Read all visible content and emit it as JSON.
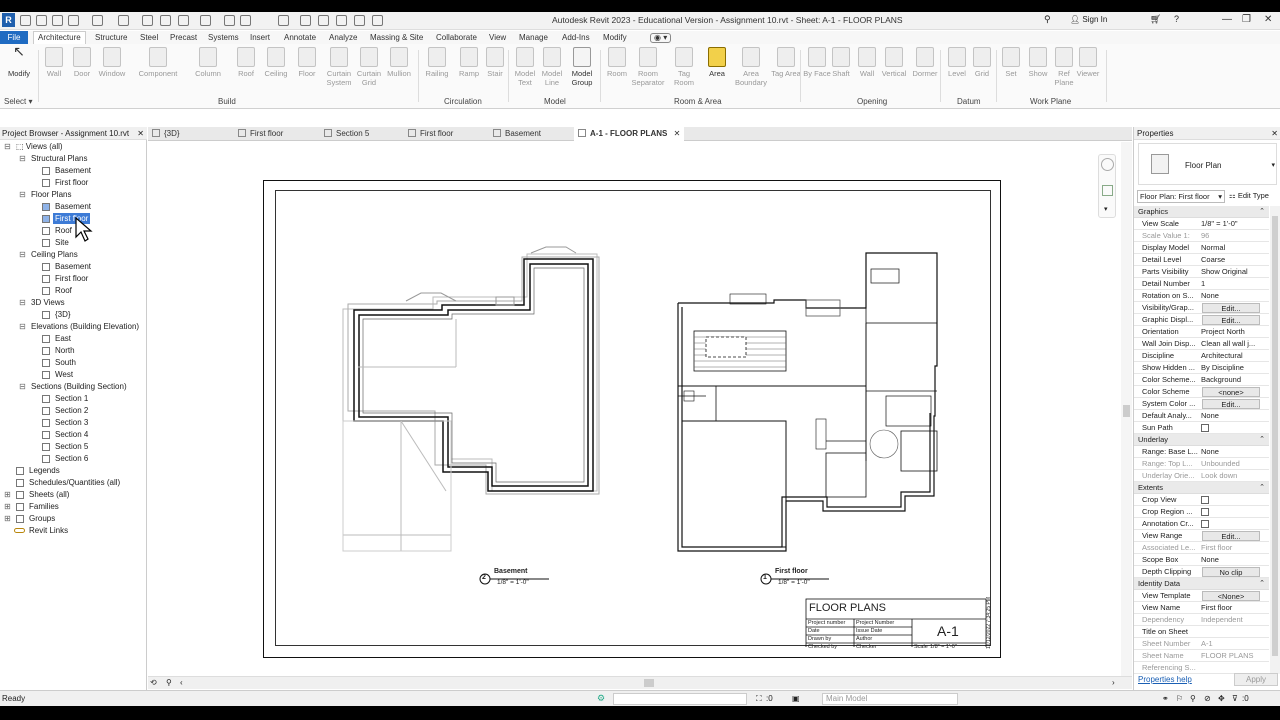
{
  "title_bar": {
    "app_title": "Autodesk Revit 2023 - Educational Version - Assignment 10.rvt - Sheet: A-1 - FLOOR PLANS",
    "sign_in": "Sign In",
    "logo": "R"
  },
  "ribbon_tabs": [
    "File",
    "Architecture",
    "Structure",
    "Steel",
    "Precast",
    "Systems",
    "Insert",
    "Annotate",
    "Analyze",
    "Massing & Site",
    "Collaborate",
    "View",
    "Manage",
    "Add-Ins",
    "Modify"
  ],
  "ribbon": {
    "modify": "Modify",
    "select": "Select",
    "groups": [
      "Build",
      "Circulation",
      "Model",
      "Room & Area",
      "Opening",
      "Datum",
      "Work Plane"
    ],
    "buttons": [
      "Wall",
      "Door",
      "Window",
      "Component",
      "Column",
      "Roof",
      "Ceiling",
      "Floor",
      "Curtain System",
      "Curtain Grid",
      "Mullion",
      "Railing",
      "Ramp",
      "Stair",
      "Model Text",
      "Model Line",
      "Model Group",
      "Room",
      "Room Separator",
      "Tag Room",
      "Area",
      "Area Boundary",
      "Tag Area",
      "By Face",
      "Shaft",
      "Wall",
      "Vertical",
      "Dormer",
      "Level",
      "Grid",
      "Set",
      "Show",
      "Ref Plane",
      "Viewer"
    ]
  },
  "project_browser": {
    "title": "Project Browser - Assignment 10.rvt",
    "tree": {
      "views_all": "Views (all)",
      "structural_plans": "Structural Plans",
      "sp_items": [
        "Basement",
        "First floor"
      ],
      "floor_plans": "Floor Plans",
      "fp_items": [
        "Basement",
        "First floor",
        "Roof",
        "Site"
      ],
      "ceiling_plans": "Ceiling Plans",
      "cp_items": [
        "Basement",
        "First floor",
        "Roof"
      ],
      "views_3d": "3D Views",
      "v3d_items": [
        "{3D}"
      ],
      "elevations": "Elevations (Building Elevation)",
      "el_items": [
        "East",
        "North",
        "South",
        "West"
      ],
      "sections": "Sections (Building Section)",
      "sec_items": [
        "Section 1",
        "Section 2",
        "Section 3",
        "Section 4",
        "Section 5",
        "Section 6"
      ],
      "legends": "Legends",
      "schedules": "Schedules/Quantities (all)",
      "sheets": "Sheets (all)",
      "families": "Families",
      "groups": "Groups",
      "revit_links": "Revit Links"
    }
  },
  "view_tabs": [
    "{3D}",
    "First floor",
    "Section 5",
    "First floor",
    "Basement",
    "A-1 - FLOOR PLANS"
  ],
  "sheet": {
    "title_block": {
      "title": "FLOOR PLANS",
      "sheet_number": "A-1",
      "rows": [
        [
          "Project number",
          "Project Number"
        ],
        [
          "Date",
          "Issue Date"
        ],
        [
          "Drawn by",
          "Author"
        ],
        [
          "Checked by",
          "Checker"
        ]
      ],
      "scale": "Scale",
      "scale_value": "1/8\" = 1'-0\"",
      "timestamp": "12/12/2022 7:34:25 PM"
    },
    "views": [
      {
        "num": "2",
        "name": "Basement",
        "scale": "1/8\" = 1'-0\""
      },
      {
        "num": "1",
        "name": "First floor",
        "scale": "1/8\" = 1'-0\""
      }
    ]
  },
  "properties": {
    "title": "Properties",
    "type": "Floor Plan",
    "selector": "Floor Plan: First floor",
    "edit_type": "Edit Type",
    "sections": {
      "graphics": "Graphics",
      "underlay": "Underlay",
      "extents": "Extents",
      "identity": "Identity Data"
    },
    "rows": {
      "view_scale": [
        "View Scale",
        "1/8\" = 1'-0\""
      ],
      "scale_value": [
        "Scale Value    1:",
        "96"
      ],
      "display_model": [
        "Display Model",
        "Normal"
      ],
      "detail_level": [
        "Detail Level",
        "Coarse"
      ],
      "parts_visibility": [
        "Parts Visibility",
        "Show Original"
      ],
      "detail_number": [
        "Detail Number",
        "1"
      ],
      "rotation": [
        "Rotation on S...",
        "None"
      ],
      "vis_graph": [
        "Visibility/Grap...",
        "Edit..."
      ],
      "graphic_disp": [
        "Graphic Displ...",
        "Edit..."
      ],
      "orientation": [
        "Orientation",
        "Project North"
      ],
      "wall_join": [
        "Wall Join Disp...",
        "Clean all wall j..."
      ],
      "discipline": [
        "Discipline",
        "Architectural"
      ],
      "show_hidden": [
        "Show Hidden ...",
        "By Discipline"
      ],
      "color_scheme_loc": [
        "Color Scheme...",
        "Background"
      ],
      "color_scheme": [
        "Color Scheme",
        "<none>"
      ],
      "system_color": [
        "System Color ...",
        "Edit..."
      ],
      "default_analy": [
        "Default Analy...",
        "None"
      ],
      "sun_path": [
        "Sun Path",
        ""
      ],
      "range_base": [
        "Range: Base L...",
        "None"
      ],
      "range_top": [
        "Range: Top L...",
        "Unbounded"
      ],
      "underlay_orient": [
        "Underlay Orie...",
        "Look down"
      ],
      "crop_view": [
        "Crop View",
        ""
      ],
      "crop_region": [
        "Crop Region ...",
        ""
      ],
      "annotation_cr": [
        "Annotation Cr...",
        ""
      ],
      "view_range": [
        "View Range",
        "Edit..."
      ],
      "associated_le": [
        "Associated Le...",
        "First floor"
      ],
      "scope_box": [
        "Scope Box",
        "None"
      ],
      "depth_clipping": [
        "Depth Clipping",
        "No clip"
      ],
      "view_template": [
        "View Template",
        "<None>"
      ],
      "view_name": [
        "View Name",
        "First floor"
      ],
      "dependency": [
        "Dependency",
        "Independent"
      ],
      "title_on_sheet": [
        "Title on Sheet",
        ""
      ],
      "sheet_number": [
        "Sheet Number",
        "A-1"
      ],
      "sheet_name": [
        "Sheet Name",
        "FLOOR PLANS"
      ],
      "referencing": [
        "Referencing S...",
        ""
      ]
    },
    "help": "Properties help",
    "apply": "Apply"
  },
  "status": {
    "ready": "Ready",
    "model": "Main Model",
    "count": ":0",
    "filter": ":0"
  }
}
